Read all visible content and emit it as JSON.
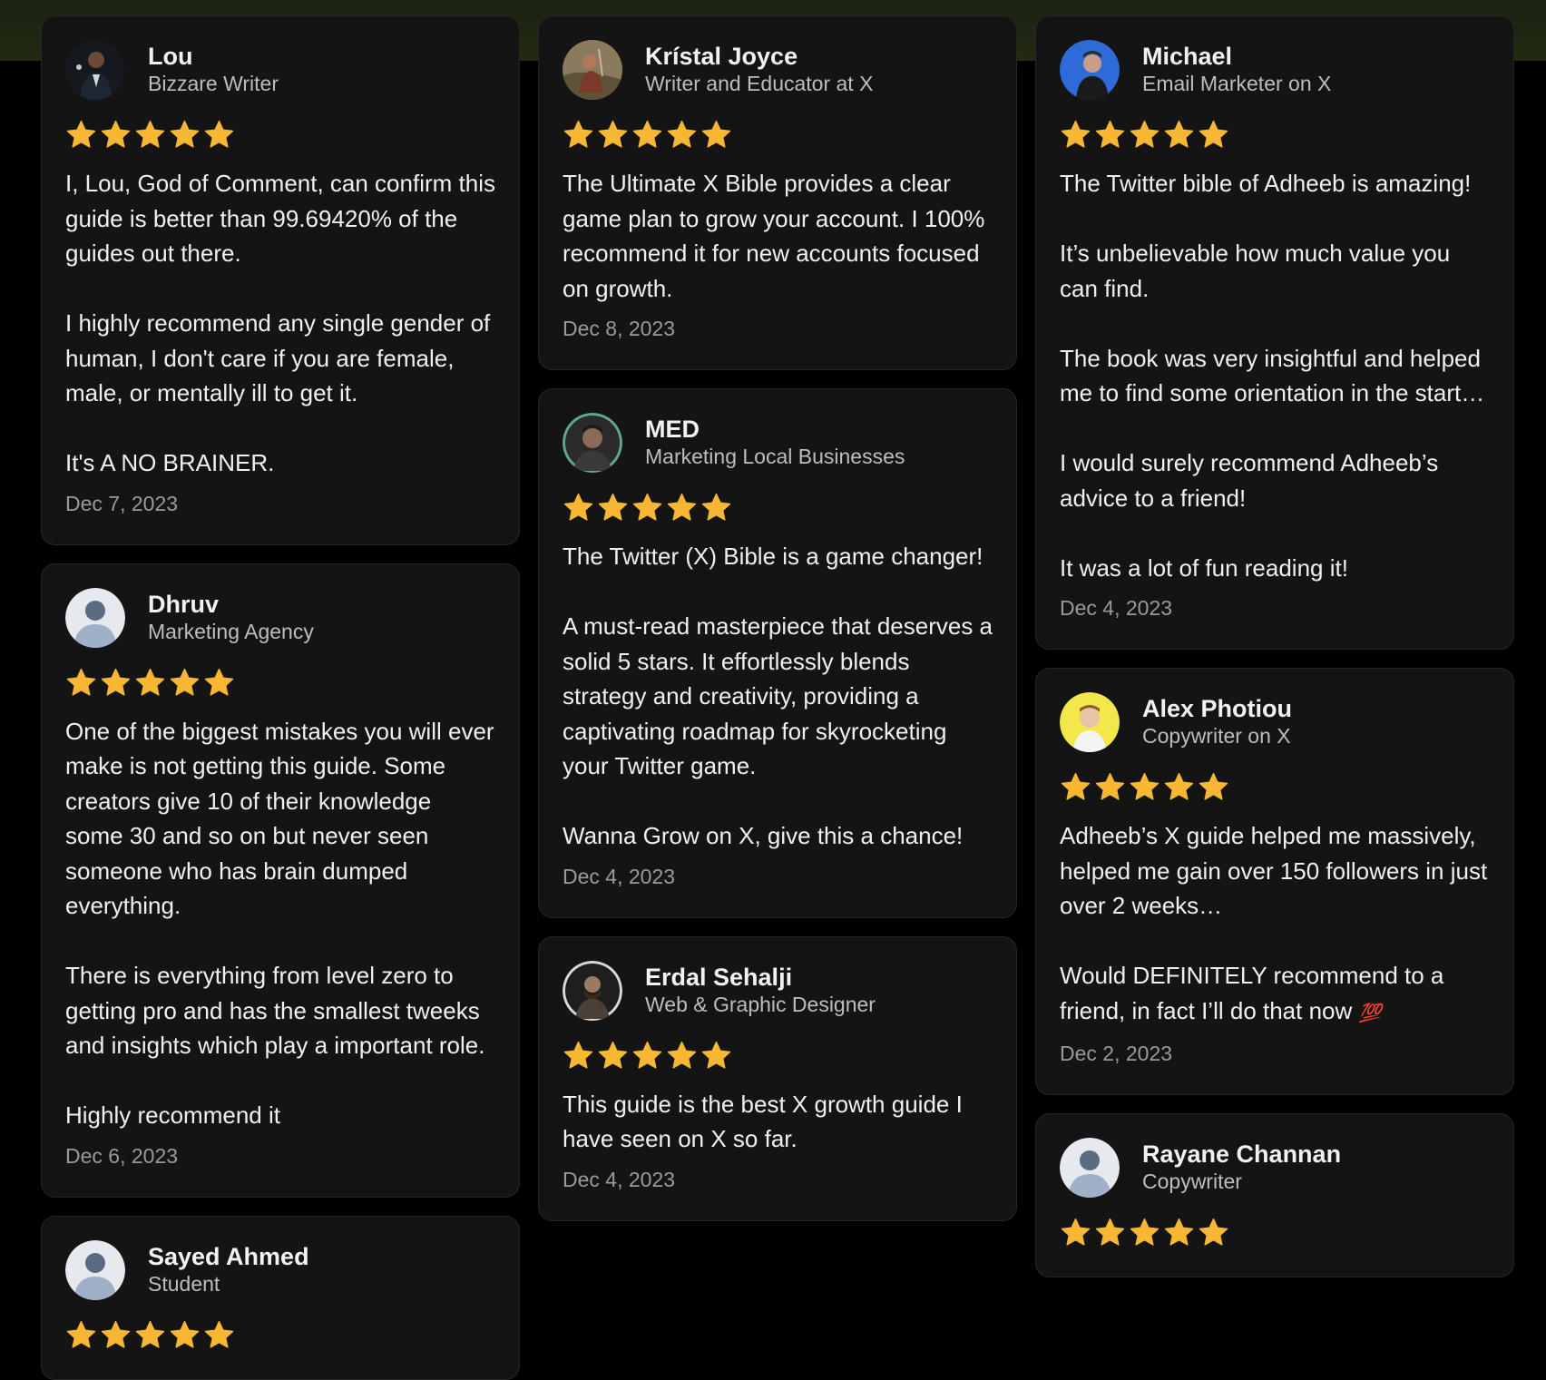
{
  "colors": {
    "page_background": "#000000",
    "top_band": "#1f2713",
    "card_background": "#141414",
    "card_border": "#262626",
    "star": "#f7b733",
    "name_text": "#f2f2f2",
    "role_text": "#bdbdbd",
    "date_text": "#9a9a9a"
  },
  "columns": [
    {
      "cards": [
        {
          "name": "Lou",
          "role": "Bizzare Writer",
          "avatar": "photo-man-dark-suit",
          "rating": 5,
          "review": "I, Lou, God of Comment, can confirm this guide is better than 99.69420% of the guides out there.\n\nI highly recommend any single gender of human, I don't care if you are female, male, or mentally ill to get it.\n\nIt's A NO BRAINER.",
          "date": "Dec 7, 2023"
        },
        {
          "name": "Dhruv",
          "role": "Marketing Agency",
          "avatar": "default-user-icon",
          "rating": 5,
          "review": "One of the biggest mistakes you will ever make is not getting this guide. Some creators give 10 of their knowledge some 30 and so on but never seen someone who has brain dumped everything.\n\nThere is everything from level zero to getting pro and has the smallest tweeks and insights which play a important role.\n\nHighly recommend it",
          "date": "Dec 6, 2023"
        },
        {
          "name": "Sayed Ahmed",
          "role": "Student",
          "avatar": "default-user-icon",
          "rating": 5,
          "review": "",
          "date": ""
        }
      ]
    },
    {
      "cards": [
        {
          "name": "Krístal Joyce",
          "role": "Writer and Educator at X",
          "avatar": "photo-woman-outdoor",
          "rating": 5,
          "review": "The Ultimate X Bible provides a clear game plan to grow your account. I 100% recommend it for new accounts focused on growth.",
          "date": "Dec 8, 2023"
        },
        {
          "name": "MED",
          "role": "Marketing Local Businesses",
          "avatar": "photo-man-green-ring",
          "rating": 5,
          "review": "The Twitter (X) Bible is a game changer!\n\nA must-read masterpiece that deserves a solid 5 stars. It effortlessly blends strategy and creativity, providing a captivating roadmap for skyrocketing your Twitter game.\n\nWanna Grow on X, give this a chance!",
          "date": "Dec 4, 2023"
        },
        {
          "name": "Erdal Sehalji",
          "role": "Web & Graphic Designer",
          "avatar": "photo-bearded-man",
          "rating": 5,
          "review": "This guide is the best X growth guide I have seen on X so far.",
          "date": "Dec 4, 2023"
        }
      ]
    },
    {
      "cards": [
        {
          "name": "Michael",
          "role": "Email Marketer on X",
          "avatar": "photo-man-blue-background",
          "rating": 5,
          "review": "The Twitter bible of Adheeb is amazing!\n\nIt’s unbelievable how much value you can find.\n\nThe book was very insightful and helped me to find some orientation in the start…\n\nI would surely recommend Adheeb’s advice to a friend!\n\nIt was a lot of fun reading it!",
          "date": "Dec 4, 2023"
        },
        {
          "name": "Alex Photiou",
          "role": "Copywriter on X",
          "avatar": "photo-man-yellow-background",
          "rating": 5,
          "review": "Adheeb’s X guide helped me massively, helped me gain over 150 followers in just over 2 weeks…\n\nWould DEFINITELY recommend to a friend, in fact I’ll do that now",
          "review_emoji": "💯",
          "date": "Dec 2, 2023"
        },
        {
          "name": "Rayane Channan",
          "role": "Copywriter",
          "avatar": "default-user-icon",
          "rating": 5,
          "review": "",
          "date": ""
        }
      ]
    }
  ]
}
